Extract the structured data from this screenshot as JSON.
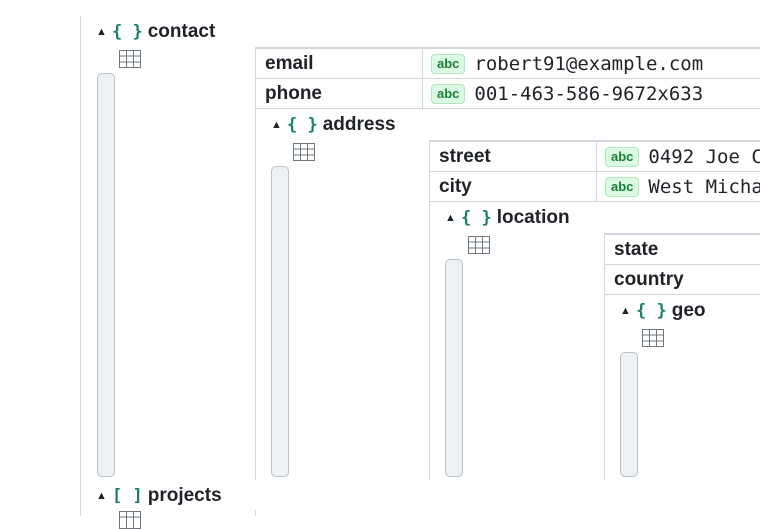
{
  "tree": {
    "contact": {
      "label": "contact",
      "brace": "{ }",
      "caret": "▲",
      "rows": [
        {
          "key": "email",
          "type": "abc",
          "value": "robert91@example.com"
        },
        {
          "key": "phone",
          "type": "abc",
          "value": "001-463-586-9672x633"
        }
      ],
      "address": {
        "label": "address",
        "brace": "{ }",
        "caret": "▲",
        "rows": [
          {
            "key": "street",
            "type": "abc",
            "value": "0492 Joe C"
          },
          {
            "key": "city",
            "type": "abc",
            "value": "West Micha"
          }
        ],
        "location": {
          "label": "location",
          "brace": "{ }",
          "caret": "▲",
          "rows": [
            {
              "key": "state"
            },
            {
              "key": "country"
            }
          ],
          "geo": {
            "label": "geo",
            "brace": "{ }",
            "caret": "▲"
          }
        }
      }
    },
    "projects": {
      "label": "projects",
      "brace": "[ ]",
      "caret": "▲"
    }
  },
  "colors": {
    "brace": "#1a7f64",
    "badge_text": "#1a7f37",
    "badge_bg": "#dafbe1",
    "border": "#d0d7de",
    "scrollbar": "#eef1f4"
  },
  "icons": {
    "table_view": "table-grid-icon",
    "collapse": "caret-up-icon"
  }
}
